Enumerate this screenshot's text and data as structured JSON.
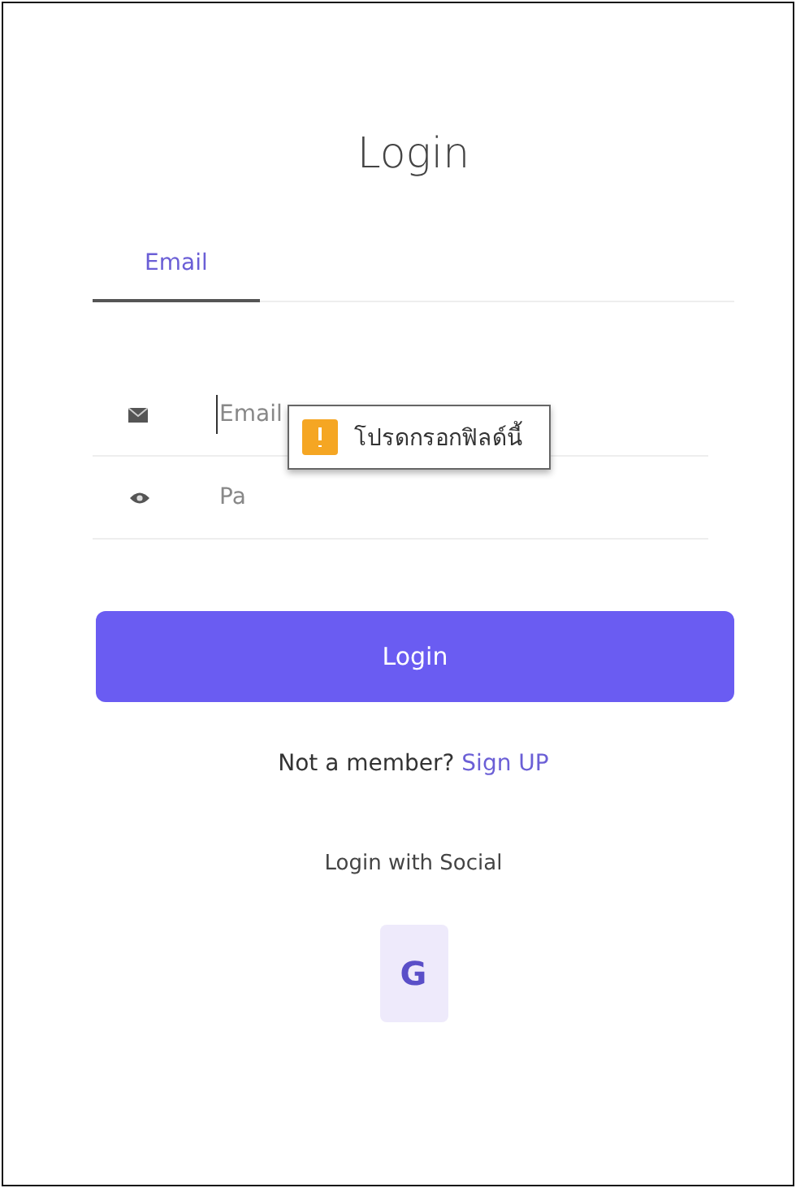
{
  "title": "Login",
  "tabs": [
    {
      "label": "Email",
      "selected": true
    }
  ],
  "fields": [
    {
      "kind": "email",
      "placeholder": "Email",
      "focused": true
    },
    {
      "kind": "password",
      "placeholder": "Pa",
      "focused": false
    }
  ],
  "tooltip": {
    "text": "โปรดกรอกฟิลด์นี้"
  },
  "login_button": "Login",
  "signup_prompt": {
    "text": "Not a member?",
    "link": "Sign UP"
  },
  "social_heading": "Login with Social",
  "social_buttons": [
    {
      "label": "G"
    }
  ]
}
